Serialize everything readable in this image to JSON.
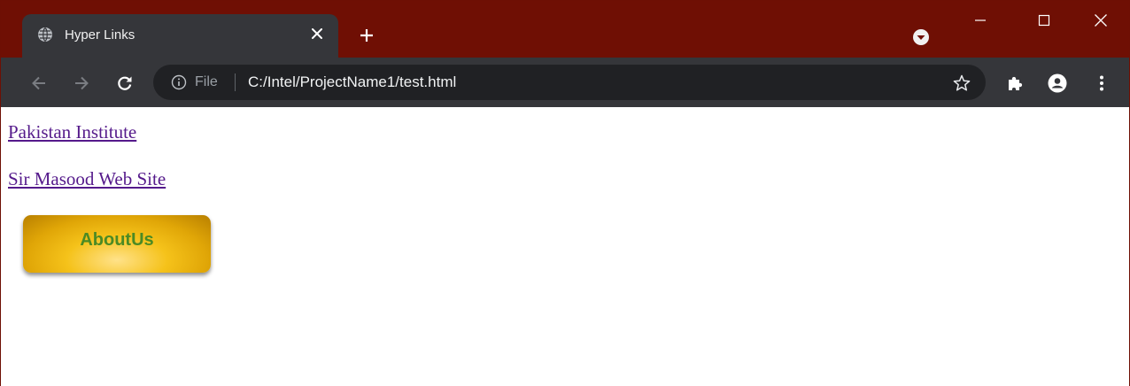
{
  "browser": {
    "tab": {
      "title": "Hyper Links",
      "favicon": "globe-icon"
    },
    "toolbar": {
      "scheme_label": "File",
      "url": "C:/Intel/ProjectName1/test.html"
    },
    "colors": {
      "titlebar": "#6f0f04",
      "toolbar": "#35363a",
      "omnibox": "#202124"
    }
  },
  "page": {
    "links": [
      {
        "label": "Pakistan Institute"
      },
      {
        "label": "Sir Masood Web Site"
      }
    ],
    "about_button": {
      "label": "AboutUs"
    },
    "colors": {
      "visited_link": "#551a8b",
      "button_gold": "#f5c21a",
      "button_text": "#4b8a24"
    }
  }
}
